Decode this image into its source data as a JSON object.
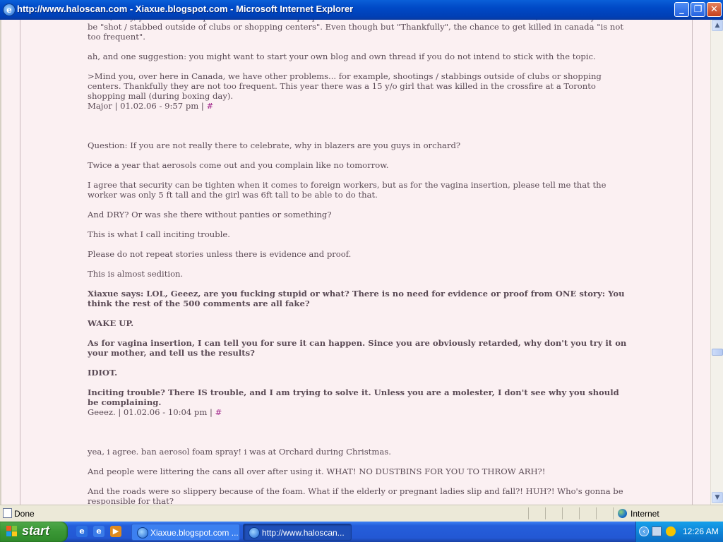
{
  "window": {
    "title": "http://www.haloscan.com - Xiaxue.blogspot.com - Microsoft Internet Explorer",
    "ie_icon": "e",
    "min_glyph": "_",
    "max_glyph": "❐",
    "close_glyph": "✕"
  },
  "posts": {
    "c1": {
      "p1": "MMX, okay, you made your point. i will tell all the people i know about this and tell them not to visit canada, because they could be \"shot / stabbed outside of clubs or shopping centers\". Even though but \"Thankfully\", the chance to get killed in canada \"is not too frequent\".",
      "p2": "ah, and one suggestion: you might want to start your own blog and own thread if you do not intend to stick with the topic.",
      "p3": ">Mind you, over here in Canada, we have other problems... for example, shootings / stabbings outside of clubs or shopping centers. Thankfully they are not too frequent. This year there was a 15 y/o girl that was killed in the crossfire at a Toronto shopping mall (during boxing day).",
      "sig": "Major | 01.02.06 - 9:57 pm |",
      "hash": "#"
    },
    "c2": {
      "p1": "Question: If you are not really there to celebrate, why in blazers are you guys in orchard?",
      "p2": "Twice a year that aerosols come out and you complain like no tomorrow.",
      "p3": "I agree that security can be tighten when it comes to foreign workers, but as for the vagina insertion, please tell me that the worker was only 5 ft tall and the girl was 6ft tall to be able to do that.",
      "p4": "And DRY? Or was she there without panties or something?",
      "p5": "This is what I call inciting trouble.",
      "p6": "Please do not repeat stories unless there is evidence and proof.",
      "p7": "This is almost sedition.",
      "b1": "Xiaxue says: LOL, Geeez, are you fucking stupid or what? There is no need for evidence or proof from ONE story: You think the rest of the 500 comments are all fake?",
      "b2": "WAKE UP.",
      "b3": "As for vagina insertion, I can tell you for sure it can happen. Since you are obviously retarded, why don't you try it on your mother, and tell us the results?",
      "b4": "IDIOT.",
      "b5": "Inciting trouble? There IS trouble, and I am trying to solve it. Unless you are a molester, I don't see why you should be complaining.",
      "sig": "Geeez. | 01.02.06 - 10:04 pm |",
      "hash": "#"
    },
    "c3": {
      "p1": "yea, i agree. ban aerosol foam spray! i was at Orchard during Christmas.",
      "p2": "And people were littering the cans all over after using it. WHAT! NO DUSTBINS FOR YOU TO THROW ARH?!",
      "p3": "And the roads were so slippery because of the foam. What if the elderly or pregnant ladies slip and fall?! HUH?! Who's gonna be responsible for that?"
    }
  },
  "scroll": {
    "up_glyph": "▲",
    "down_glyph": "▼"
  },
  "status": {
    "text": "Done",
    "zone": "Internet"
  },
  "taskbar": {
    "start_label": "start",
    "ql_ie": "e",
    "ql_2": "e",
    "ql_3": "▶",
    "tasks": [
      {
        "label": "Xiaxue.blogspot.com ..."
      },
      {
        "label": "http://www.haloscan..."
      }
    ],
    "tray_arrow": "‹",
    "clock": "12:26 AM"
  },
  "colors": {
    "page_bg": "#fbf0f2",
    "text": "#5a4a55",
    "link": "#a0248a",
    "title_bar": "#0049c6",
    "start_green": "#3a9735",
    "tray_blue": "#0f86d8"
  }
}
